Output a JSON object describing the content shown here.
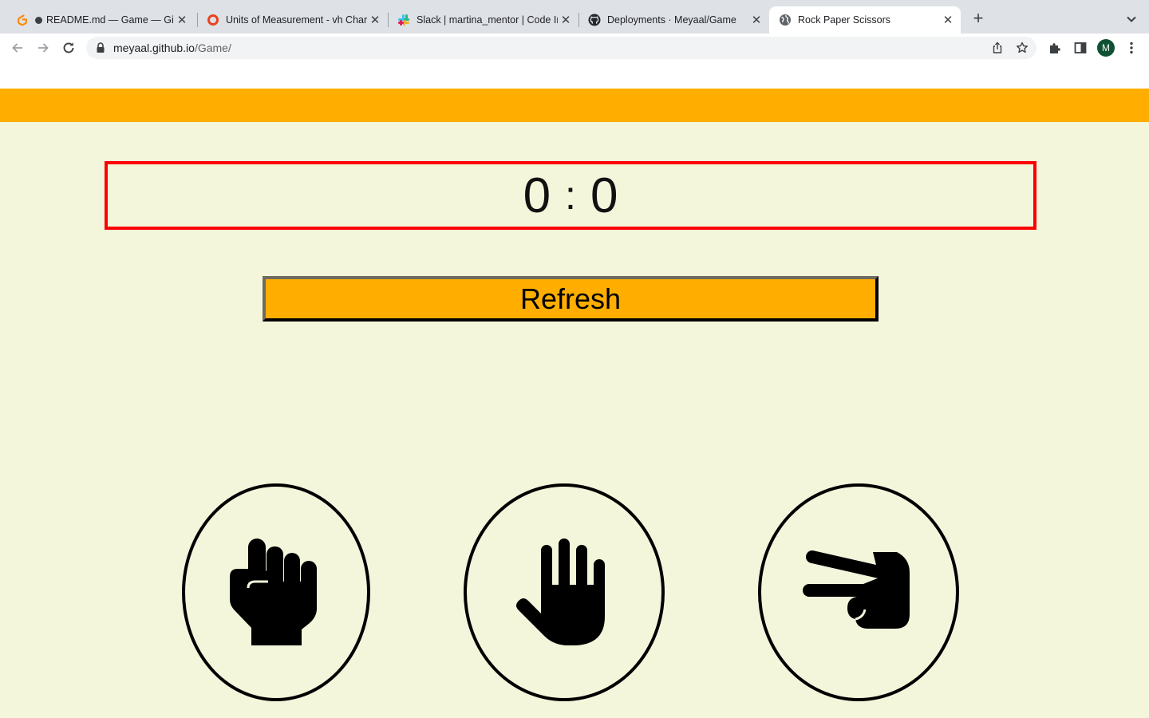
{
  "browser": {
    "tabs": [
      {
        "title": "README.md — Game — Gitpod",
        "favicon": "gitpod-icon",
        "unsaved_dot": true,
        "active": false
      },
      {
        "title": "Units of Measurement - vh Chart",
        "favicon": "circle-ring-icon",
        "active": false
      },
      {
        "title": "Slack | martina_mentor | Code Institute",
        "favicon": "slack-icon",
        "active": false
      },
      {
        "title": "Deployments · Meyaal/Game",
        "favicon": "github-icon",
        "active": false
      },
      {
        "title": "Rock Paper Scissors",
        "favicon": "globe-icon",
        "active": true
      }
    ],
    "url_host": "meyaal.github.io",
    "url_path": "/Game/",
    "profile_initial": "M"
  },
  "game": {
    "player_score": "0",
    "separator": ":",
    "computer_score": "0",
    "refresh_label": "Refresh",
    "choices": [
      {
        "name": "rock",
        "icon": "hand-rock-icon"
      },
      {
        "name": "paper",
        "icon": "hand-paper-icon"
      },
      {
        "name": "scissors",
        "icon": "hand-scissors-icon"
      }
    ]
  },
  "colors": {
    "header_bar": "#ffae00",
    "page_background": "#f3f6db",
    "scoreboard_border": "#ff0000",
    "button_background": "#ffae00"
  }
}
